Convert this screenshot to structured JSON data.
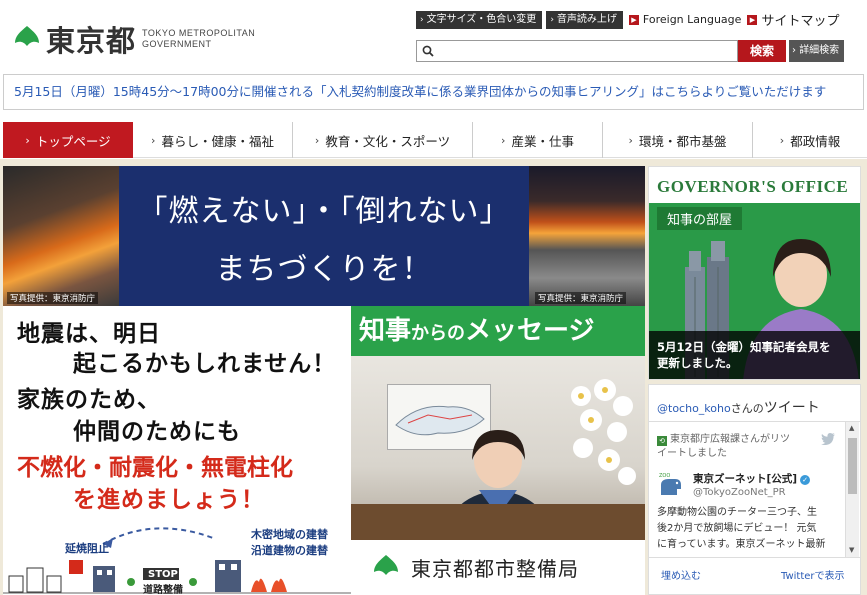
{
  "brand": {
    "name_ja": "東京都",
    "name_en_1": "TOKYO METROPOLITAN",
    "name_en_2": "GOVERNMENT",
    "color": "#2aa24a"
  },
  "utility": {
    "text_size": "文字サイズ・色合い変更",
    "voice": "音声読み上げ",
    "foreign": "Foreign Language",
    "sitemap": "サイトマップ"
  },
  "search": {
    "value": "",
    "placeholder": "",
    "button": "検索",
    "advanced": "詳細検索"
  },
  "notice": "5月15日（月曜）15時45分～17時00分に開催される「入札契約制度改革に係る業界団体からの知事ヒアリング」はこちらよりご覧いただけます",
  "nav": [
    {
      "label": "トップページ",
      "active": true
    },
    {
      "label": "暮らし・健康・福祉",
      "active": false
    },
    {
      "label": "教育・文化・スポーツ",
      "active": false
    },
    {
      "label": "産業・仕事",
      "active": false
    },
    {
      "label": "環境・都市基盤",
      "active": false
    },
    {
      "label": "都政情報",
      "active": false
    }
  ],
  "banner": {
    "headline_1": "「燃えない」・「倒れない」",
    "headline_2": "まちづくりを！",
    "photo_credit": "写真提供：東京消防庁",
    "line_1": "地震は、明日",
    "line_2": "起こるかもしれません！",
    "line_3": "家族のため、",
    "line_4": "仲間のためにも",
    "line_5": "不燃化・耐震化・無電柱化",
    "line_6": "を進めましょう！",
    "ill_spread": "延焼阻止",
    "ill_rebuild_1": "木密地域の建替",
    "ill_rebuild_2": "沿道建物の建替",
    "ill_stop": "STOP",
    "ill_road": "道路整備",
    "message_1": "知事",
    "message_2": "からの",
    "message_3": "メッセージ",
    "bureau": "東京都都市整備局",
    "accent_red": "#d42a1a",
    "navy": "#1b2f6e"
  },
  "governor": {
    "title": "GOVERNOR'S OFFICE",
    "subtitle": "知事の部屋",
    "caption_1": "5月12日（金曜）知事記者会見を",
    "caption_2": "更新しました。"
  },
  "twitter": {
    "handle_link": "@tocho_koho",
    "handle_suffix": "さんの",
    "heading": "ツイート",
    "retweet_1": "東京都庁広報課さんがリツ",
    "retweet_2": "イートしました",
    "account": "東京ズーネット[公式]",
    "account_handle": "@TokyoZooNet_PR",
    "body_1": "多摩動物公園のチーター三つ子、生",
    "body_2": "後2か月で放飼場にデビュー！ 元気",
    "body_3": "に育っています。東京ズーネット最新",
    "embed": "埋め込む",
    "view": "Twitterで表示"
  }
}
